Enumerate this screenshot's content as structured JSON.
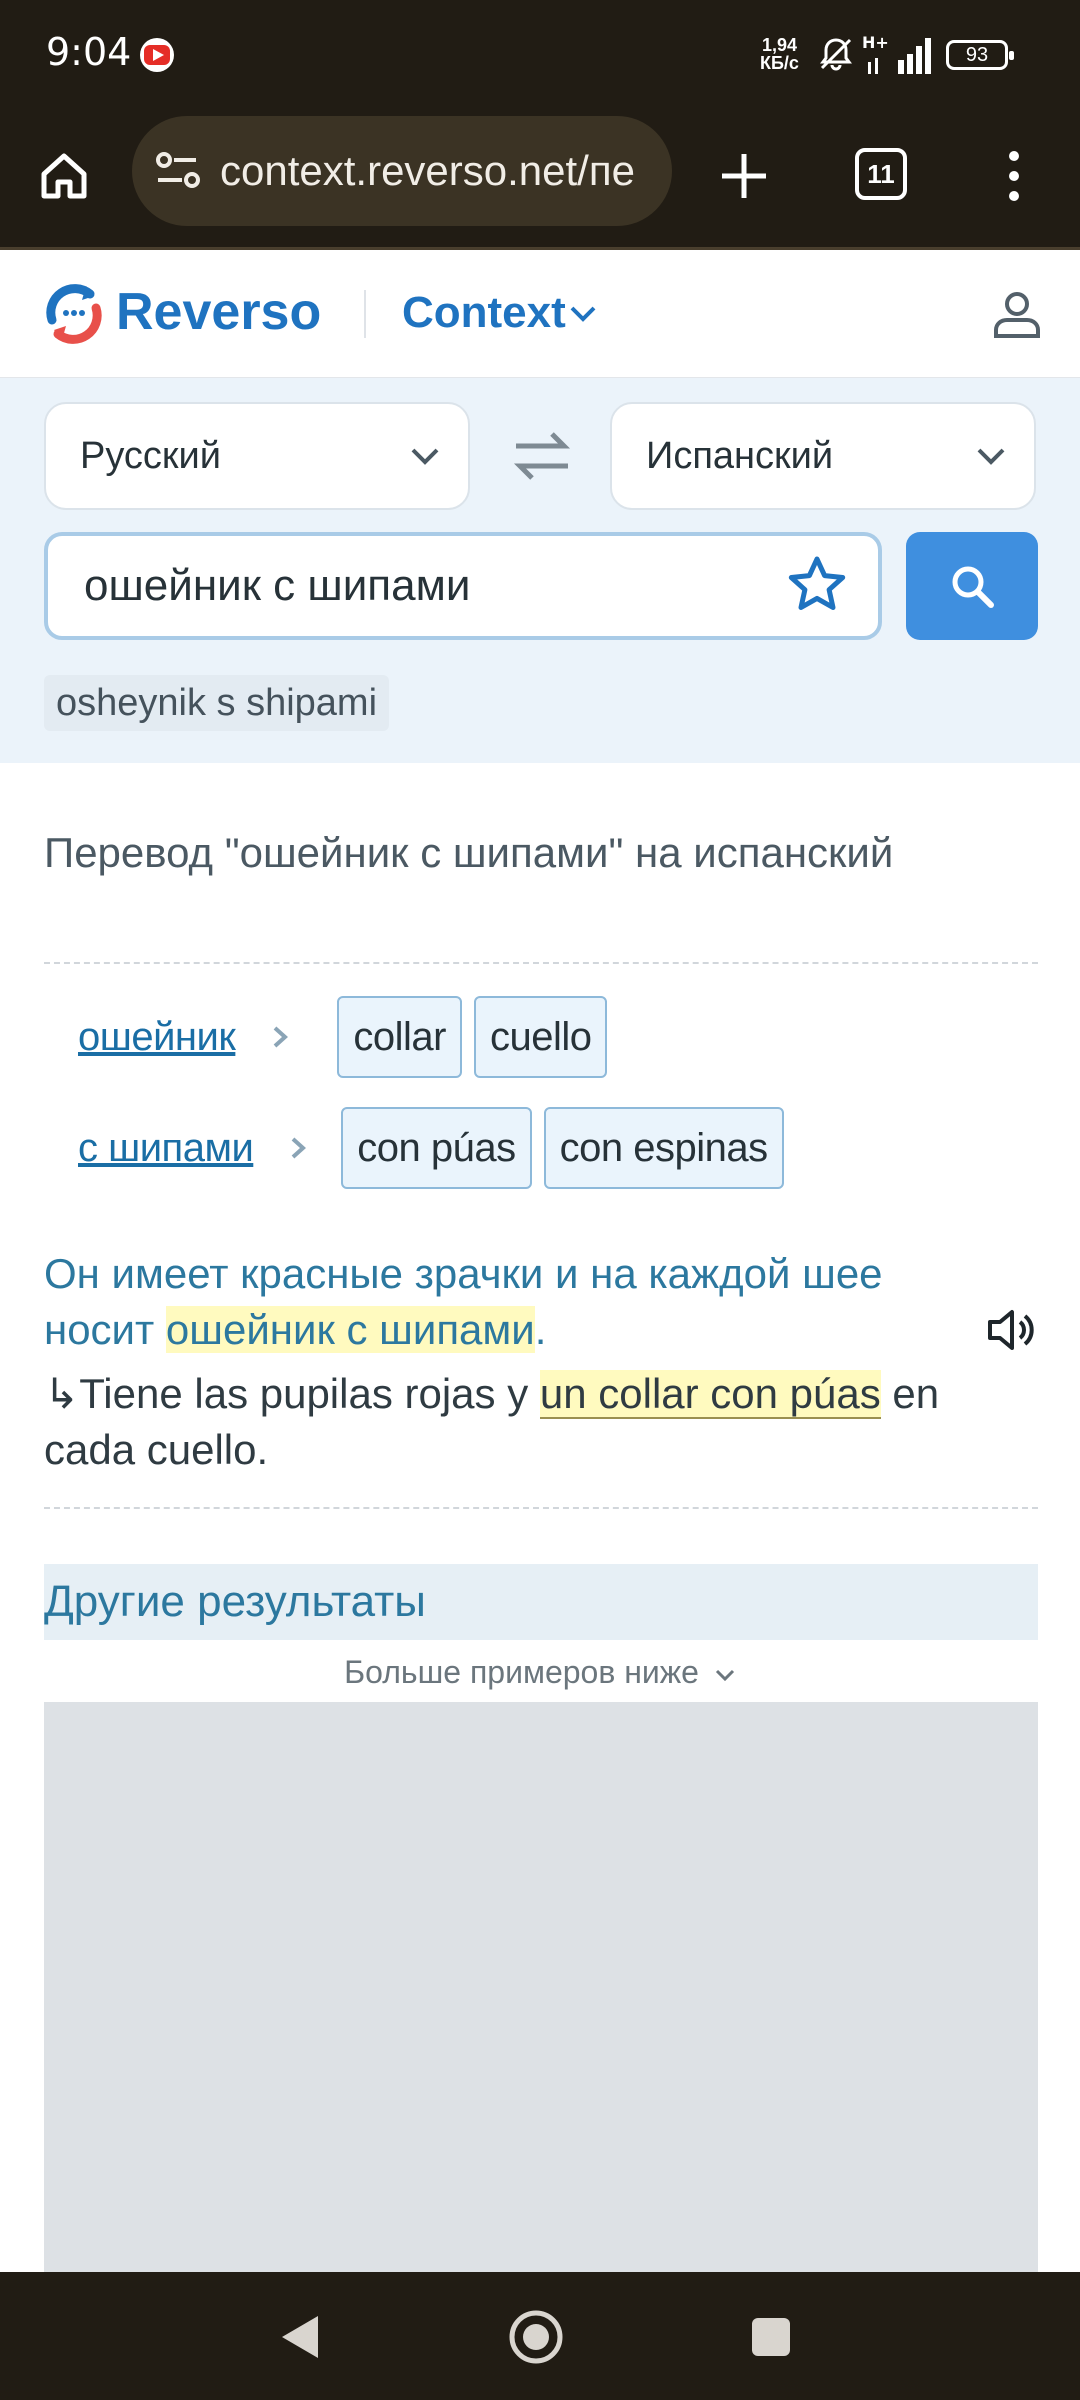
{
  "status_bar": {
    "time": "9:04",
    "speed_value": "1,94",
    "speed_unit": "КБ/с",
    "network": "H+",
    "battery": "93",
    "icons": [
      "youtube-icon",
      "bell-off-icon",
      "signal-icon",
      "battery-icon"
    ]
  },
  "browser": {
    "url": "context.reverso.net/пе",
    "tab_count": "11",
    "icons": [
      "home-icon",
      "site-settings-icon",
      "new-tab-icon",
      "tabs-icon",
      "more-icon"
    ]
  },
  "header": {
    "brand": "Reverso",
    "product": "Context",
    "icons": [
      "reverso-logo",
      "chevron-down-icon",
      "user-icon"
    ]
  },
  "search": {
    "source_lang": "Русский",
    "target_lang": "Испанский",
    "query": "ошейник с шипами",
    "transliteration": "osheynik s shipami",
    "accent": "#3f8fdf"
  },
  "result": {
    "title": "Перевод \"ошейник с шипами\" на испанский",
    "rows": [
      {
        "word": "ошейник",
        "translations": [
          "collar",
          "cuello"
        ]
      },
      {
        "word": "с шипами",
        "translations": [
          "con púas",
          "con espinas"
        ]
      }
    ],
    "example": {
      "source_before": "Он имеет красные зрачки и на каждой шее носит ",
      "source_highlight": "ошейник с шипами",
      "source_after": ".",
      "arrow": "↳",
      "target_before": "Tiene las pupilas rojas y ",
      "target_highlight": "un collar con púas",
      "target_after": " en cada cuello."
    },
    "other_results": "Другие результаты",
    "more_examples": "Больше примеров ниже"
  },
  "nav_bar": {
    "icons": [
      "back-icon",
      "home-circle-icon",
      "recents-icon"
    ]
  }
}
